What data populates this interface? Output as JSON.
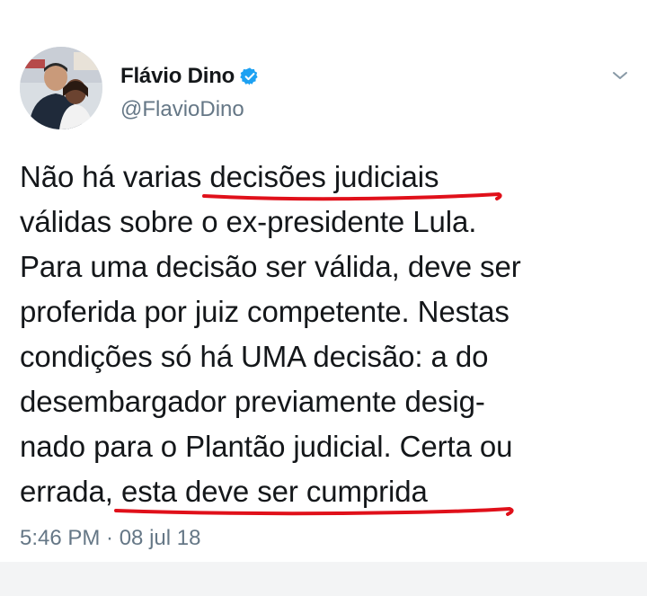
{
  "tweet": {
    "author": {
      "display_name": "Flávio Dino",
      "handle": "@FlavioDino",
      "verified": true
    },
    "text_lines": [
      {
        "before": "Não há varias ",
        "marked": "decisões judiciais",
        "after": ""
      },
      {
        "before": "válidas sobre o ex-presidente Lula.",
        "marked": "",
        "after": ""
      },
      {
        "before": "Para uma decisão ser válida, deve ser",
        "marked": "",
        "after": ""
      },
      {
        "before": "proferida por juiz competente. Nestas",
        "marked": "",
        "after": ""
      },
      {
        "before": "condições só há UMA decisão: a do",
        "marked": "",
        "after": ""
      },
      {
        "before": "desembargador previamente desig-",
        "marked": "",
        "after": ""
      },
      {
        "before": "nado para o Plantão judicial. Certa ou",
        "marked": "",
        "after": ""
      },
      {
        "before": "errada, ",
        "marked": "esta deve ser cumprida",
        "after": ""
      }
    ],
    "timestamp": "5:46 PM · 08 jul 18"
  },
  "colors": {
    "text": "#14171a",
    "secondary": "#657786",
    "verified_badge": "#1da1f2",
    "annotation_underline": "#e0101a"
  },
  "icons": {
    "verified": "verified-badge-icon",
    "menu": "chevron-down-icon"
  }
}
